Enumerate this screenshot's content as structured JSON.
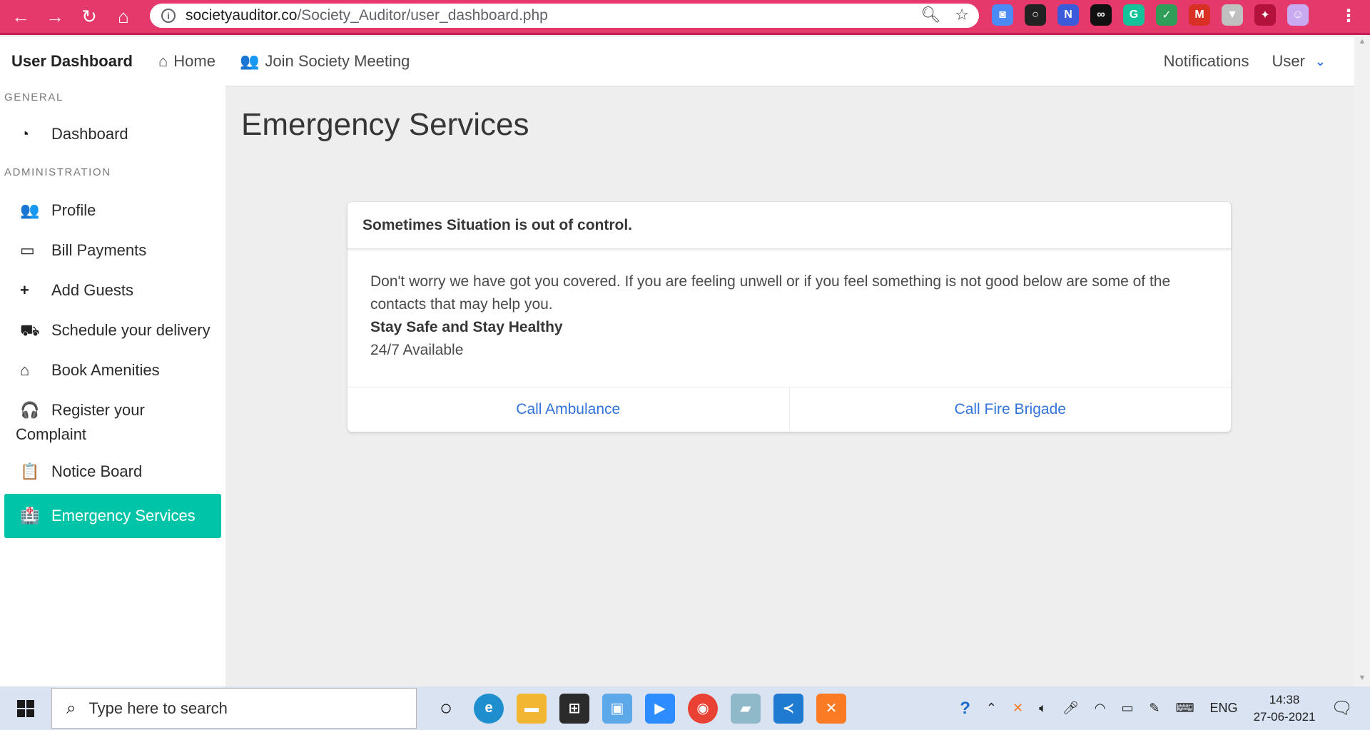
{
  "browser": {
    "url_domain": "societyauditor.co",
    "url_path": "/Society_Auditor/user_dashboard.php",
    "extensions": [
      {
        "name": "camera-ext-icon",
        "glyph": "◙",
        "color": "#4c8bf5"
      },
      {
        "name": "opera-ext-icon",
        "glyph": "○",
        "color": "#222222"
      },
      {
        "name": "n-ext-icon",
        "glyph": "N",
        "color": "#3b5bdb"
      },
      {
        "name": "infinity-ext-icon",
        "glyph": "∞",
        "color": "#111111"
      },
      {
        "name": "grammarly-ext-icon",
        "glyph": "G",
        "color": "#15c39a"
      },
      {
        "name": "check-ext-icon",
        "glyph": "✓",
        "color": "#2e9e58"
      },
      {
        "name": "m-ext-icon",
        "glyph": "M",
        "color": "#d93025"
      },
      {
        "name": "shield-ext-icon",
        "glyph": "▼",
        "color": "#c0c0c0"
      },
      {
        "name": "puzzle-ext-icon",
        "glyph": "✦",
        "color": "#b3123c"
      },
      {
        "name": "avatar-ext-icon",
        "glyph": "☺",
        "color": "#c9a9f0"
      }
    ]
  },
  "topnav": {
    "brand": "User Dashboard",
    "home": "Home",
    "join": "Join Society Meeting",
    "notifications": "Notifications",
    "user": "User"
  },
  "sidebar": {
    "general_label": "GENERAL",
    "admin_label": "ADMINISTRATION",
    "dashboard": "Dashboard",
    "items": [
      {
        "label": "Profile",
        "icon": "users-cog-icon",
        "glyph": "👥"
      },
      {
        "label": "Bill Payments",
        "icon": "credit-card-icon",
        "glyph": "▭"
      },
      {
        "label": "Add Guests",
        "icon": "plus-icon",
        "glyph": "+"
      },
      {
        "label": "Schedule your delivery",
        "icon": "truck-icon",
        "glyph": "⛟"
      },
      {
        "label": "Book Amenities",
        "icon": "store-icon",
        "glyph": "⌂"
      },
      {
        "label_line1": "Register your",
        "label_line2": "Complaint",
        "icon": "headset-icon",
        "glyph": "🎧"
      },
      {
        "label": "Notice Board",
        "icon": "clipboard-icon",
        "glyph": "📋"
      },
      {
        "label": "Emergency Services",
        "icon": "hospital-icon",
        "glyph": "🏥"
      }
    ]
  },
  "main": {
    "title": "Emergency Services",
    "card": {
      "header": "Sometimes Situation is out of control.",
      "body_text": "Don't worry we have got you covered. If you are feeling unwell or if you feel something is not good below are some of the contacts that may help you.",
      "strong": "Stay Safe and Stay Healthy",
      "availability": "24/7 Available",
      "btn_ambulance": "Call Ambulance",
      "btn_fire": "Call Fire Brigade"
    }
  },
  "taskbar": {
    "search_placeholder": "Type here to search",
    "lang": "ENG",
    "time": "14:38",
    "date": "27-06-2021"
  }
}
